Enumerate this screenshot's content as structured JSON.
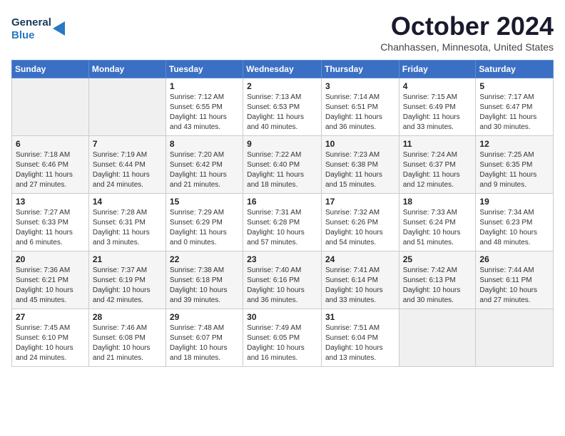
{
  "logo": {
    "line1": "General",
    "line2": "Blue"
  },
  "title": "October 2024",
  "location": "Chanhassen, Minnesota, United States",
  "header_days": [
    "Sunday",
    "Monday",
    "Tuesday",
    "Wednesday",
    "Thursday",
    "Friday",
    "Saturday"
  ],
  "weeks": [
    [
      {
        "day": "",
        "sunrise": "",
        "sunset": "",
        "daylight": ""
      },
      {
        "day": "",
        "sunrise": "",
        "sunset": "",
        "daylight": ""
      },
      {
        "day": "1",
        "sunrise": "Sunrise: 7:12 AM",
        "sunset": "Sunset: 6:55 PM",
        "daylight": "Daylight: 11 hours and 43 minutes."
      },
      {
        "day": "2",
        "sunrise": "Sunrise: 7:13 AM",
        "sunset": "Sunset: 6:53 PM",
        "daylight": "Daylight: 11 hours and 40 minutes."
      },
      {
        "day": "3",
        "sunrise": "Sunrise: 7:14 AM",
        "sunset": "Sunset: 6:51 PM",
        "daylight": "Daylight: 11 hours and 36 minutes."
      },
      {
        "day": "4",
        "sunrise": "Sunrise: 7:15 AM",
        "sunset": "Sunset: 6:49 PM",
        "daylight": "Daylight: 11 hours and 33 minutes."
      },
      {
        "day": "5",
        "sunrise": "Sunrise: 7:17 AM",
        "sunset": "Sunset: 6:47 PM",
        "daylight": "Daylight: 11 hours and 30 minutes."
      }
    ],
    [
      {
        "day": "6",
        "sunrise": "Sunrise: 7:18 AM",
        "sunset": "Sunset: 6:46 PM",
        "daylight": "Daylight: 11 hours and 27 minutes."
      },
      {
        "day": "7",
        "sunrise": "Sunrise: 7:19 AM",
        "sunset": "Sunset: 6:44 PM",
        "daylight": "Daylight: 11 hours and 24 minutes."
      },
      {
        "day": "8",
        "sunrise": "Sunrise: 7:20 AM",
        "sunset": "Sunset: 6:42 PM",
        "daylight": "Daylight: 11 hours and 21 minutes."
      },
      {
        "day": "9",
        "sunrise": "Sunrise: 7:22 AM",
        "sunset": "Sunset: 6:40 PM",
        "daylight": "Daylight: 11 hours and 18 minutes."
      },
      {
        "day": "10",
        "sunrise": "Sunrise: 7:23 AM",
        "sunset": "Sunset: 6:38 PM",
        "daylight": "Daylight: 11 hours and 15 minutes."
      },
      {
        "day": "11",
        "sunrise": "Sunrise: 7:24 AM",
        "sunset": "Sunset: 6:37 PM",
        "daylight": "Daylight: 11 hours and 12 minutes."
      },
      {
        "day": "12",
        "sunrise": "Sunrise: 7:25 AM",
        "sunset": "Sunset: 6:35 PM",
        "daylight": "Daylight: 11 hours and 9 minutes."
      }
    ],
    [
      {
        "day": "13",
        "sunrise": "Sunrise: 7:27 AM",
        "sunset": "Sunset: 6:33 PM",
        "daylight": "Daylight: 11 hours and 6 minutes."
      },
      {
        "day": "14",
        "sunrise": "Sunrise: 7:28 AM",
        "sunset": "Sunset: 6:31 PM",
        "daylight": "Daylight: 11 hours and 3 minutes."
      },
      {
        "day": "15",
        "sunrise": "Sunrise: 7:29 AM",
        "sunset": "Sunset: 6:29 PM",
        "daylight": "Daylight: 11 hours and 0 minutes."
      },
      {
        "day": "16",
        "sunrise": "Sunrise: 7:31 AM",
        "sunset": "Sunset: 6:28 PM",
        "daylight": "Daylight: 10 hours and 57 minutes."
      },
      {
        "day": "17",
        "sunrise": "Sunrise: 7:32 AM",
        "sunset": "Sunset: 6:26 PM",
        "daylight": "Daylight: 10 hours and 54 minutes."
      },
      {
        "day": "18",
        "sunrise": "Sunrise: 7:33 AM",
        "sunset": "Sunset: 6:24 PM",
        "daylight": "Daylight: 10 hours and 51 minutes."
      },
      {
        "day": "19",
        "sunrise": "Sunrise: 7:34 AM",
        "sunset": "Sunset: 6:23 PM",
        "daylight": "Daylight: 10 hours and 48 minutes."
      }
    ],
    [
      {
        "day": "20",
        "sunrise": "Sunrise: 7:36 AM",
        "sunset": "Sunset: 6:21 PM",
        "daylight": "Daylight: 10 hours and 45 minutes."
      },
      {
        "day": "21",
        "sunrise": "Sunrise: 7:37 AM",
        "sunset": "Sunset: 6:19 PM",
        "daylight": "Daylight: 10 hours and 42 minutes."
      },
      {
        "day": "22",
        "sunrise": "Sunrise: 7:38 AM",
        "sunset": "Sunset: 6:18 PM",
        "daylight": "Daylight: 10 hours and 39 minutes."
      },
      {
        "day": "23",
        "sunrise": "Sunrise: 7:40 AM",
        "sunset": "Sunset: 6:16 PM",
        "daylight": "Daylight: 10 hours and 36 minutes."
      },
      {
        "day": "24",
        "sunrise": "Sunrise: 7:41 AM",
        "sunset": "Sunset: 6:14 PM",
        "daylight": "Daylight: 10 hours and 33 minutes."
      },
      {
        "day": "25",
        "sunrise": "Sunrise: 7:42 AM",
        "sunset": "Sunset: 6:13 PM",
        "daylight": "Daylight: 10 hours and 30 minutes."
      },
      {
        "day": "26",
        "sunrise": "Sunrise: 7:44 AM",
        "sunset": "Sunset: 6:11 PM",
        "daylight": "Daylight: 10 hours and 27 minutes."
      }
    ],
    [
      {
        "day": "27",
        "sunrise": "Sunrise: 7:45 AM",
        "sunset": "Sunset: 6:10 PM",
        "daylight": "Daylight: 10 hours and 24 minutes."
      },
      {
        "day": "28",
        "sunrise": "Sunrise: 7:46 AM",
        "sunset": "Sunset: 6:08 PM",
        "daylight": "Daylight: 10 hours and 21 minutes."
      },
      {
        "day": "29",
        "sunrise": "Sunrise: 7:48 AM",
        "sunset": "Sunset: 6:07 PM",
        "daylight": "Daylight: 10 hours and 18 minutes."
      },
      {
        "day": "30",
        "sunrise": "Sunrise: 7:49 AM",
        "sunset": "Sunset: 6:05 PM",
        "daylight": "Daylight: 10 hours and 16 minutes."
      },
      {
        "day": "31",
        "sunrise": "Sunrise: 7:51 AM",
        "sunset": "Sunset: 6:04 PM",
        "daylight": "Daylight: 10 hours and 13 minutes."
      },
      {
        "day": "",
        "sunrise": "",
        "sunset": "",
        "daylight": ""
      },
      {
        "day": "",
        "sunrise": "",
        "sunset": "",
        "daylight": ""
      }
    ]
  ]
}
